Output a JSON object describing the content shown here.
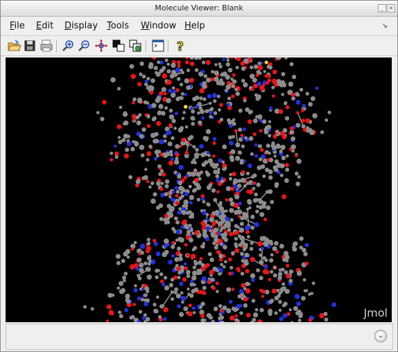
{
  "window": {
    "title": "Molecule Viewer: Blank"
  },
  "menubar": {
    "items": [
      {
        "mnemonic": "F",
        "rest": "ile"
      },
      {
        "mnemonic": "E",
        "rest": "dit"
      },
      {
        "mnemonic": "D",
        "rest": "isplay"
      },
      {
        "mnemonic": "T",
        "rest": "ools"
      },
      {
        "mnemonic": "W",
        "rest": "indow"
      },
      {
        "mnemonic": "H",
        "rest": "elp"
      }
    ]
  },
  "toolbar": {
    "icons": [
      "open-folder-icon",
      "save-icon",
      "print-icon",
      "zoom-in-icon",
      "zoom-out-icon",
      "rotate-icon",
      "copy-icon",
      "export-icon",
      "console-icon",
      "help-icon"
    ]
  },
  "viewer": {
    "watermark": "Jmol",
    "atom_colors": {
      "carbon": "#8c8c8c",
      "oxygen": "#e8151b",
      "nitrogen": "#2231e0",
      "sulfur": "#f0e020"
    }
  }
}
